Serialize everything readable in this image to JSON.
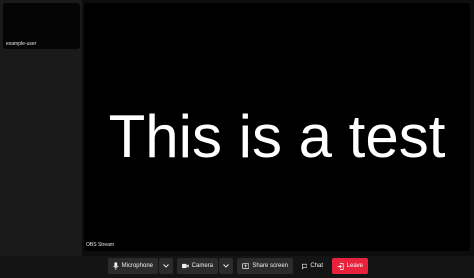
{
  "participants": [
    {
      "name": "example-user"
    }
  ],
  "stage": {
    "text": "This is a test",
    "label": "OBS Stream"
  },
  "toolbar": {
    "microphone_label": "Microphone",
    "camera_label": "Camera",
    "share_label": "Share screen",
    "chat_label": "Chat",
    "leave_label": "Leave"
  },
  "colors": {
    "leave": "#e8213c",
    "stage_bg": "#000000",
    "button_bg": "#2b2b2b"
  }
}
